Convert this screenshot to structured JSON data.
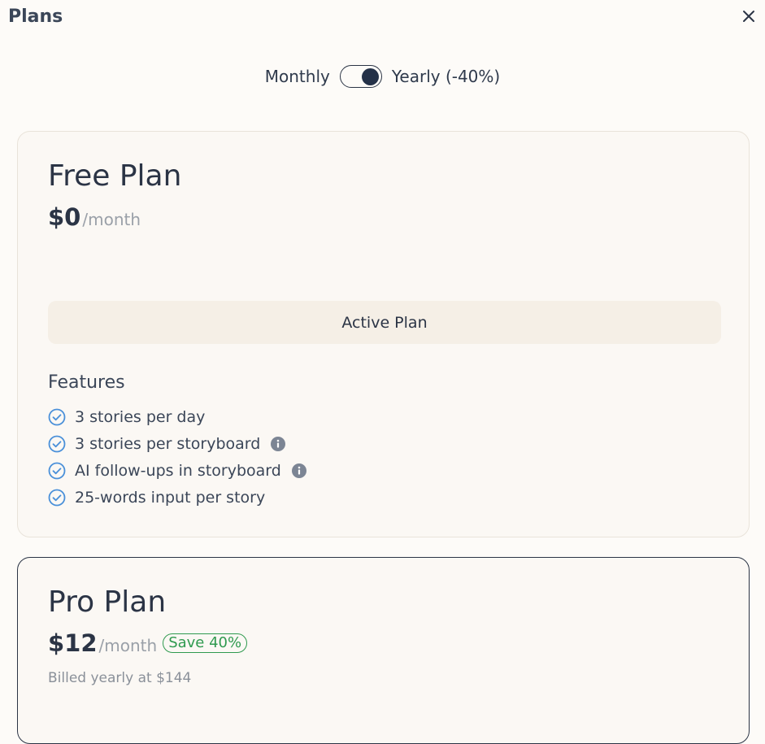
{
  "header": {
    "title": "Plans"
  },
  "billing_toggle": {
    "monthly_label": "Monthly",
    "yearly_label": "Yearly (-40%)",
    "selected": "yearly"
  },
  "plans": [
    {
      "name": "Free Plan",
      "price": "$0",
      "period": "/month",
      "action_label": "Active Plan",
      "features_title": "Features",
      "features": [
        {
          "text": "3 stories per day",
          "info": false
        },
        {
          "text": "3 stories per storyboard",
          "info": true
        },
        {
          "text": "AI follow-ups in storyboard",
          "info": true
        },
        {
          "text": "25-words input per story",
          "info": false
        }
      ]
    },
    {
      "name": "Pro Plan",
      "price": "$12",
      "period": "/month",
      "badge": "Save 40%",
      "billed_note": "Billed yearly at $144"
    }
  ],
  "colors": {
    "accent": "#243148",
    "check": "#4a90d9",
    "save": "#2f9a4f"
  },
  "icons": {
    "close": "close-icon",
    "check": "check-circle-icon",
    "info": "info-icon"
  }
}
